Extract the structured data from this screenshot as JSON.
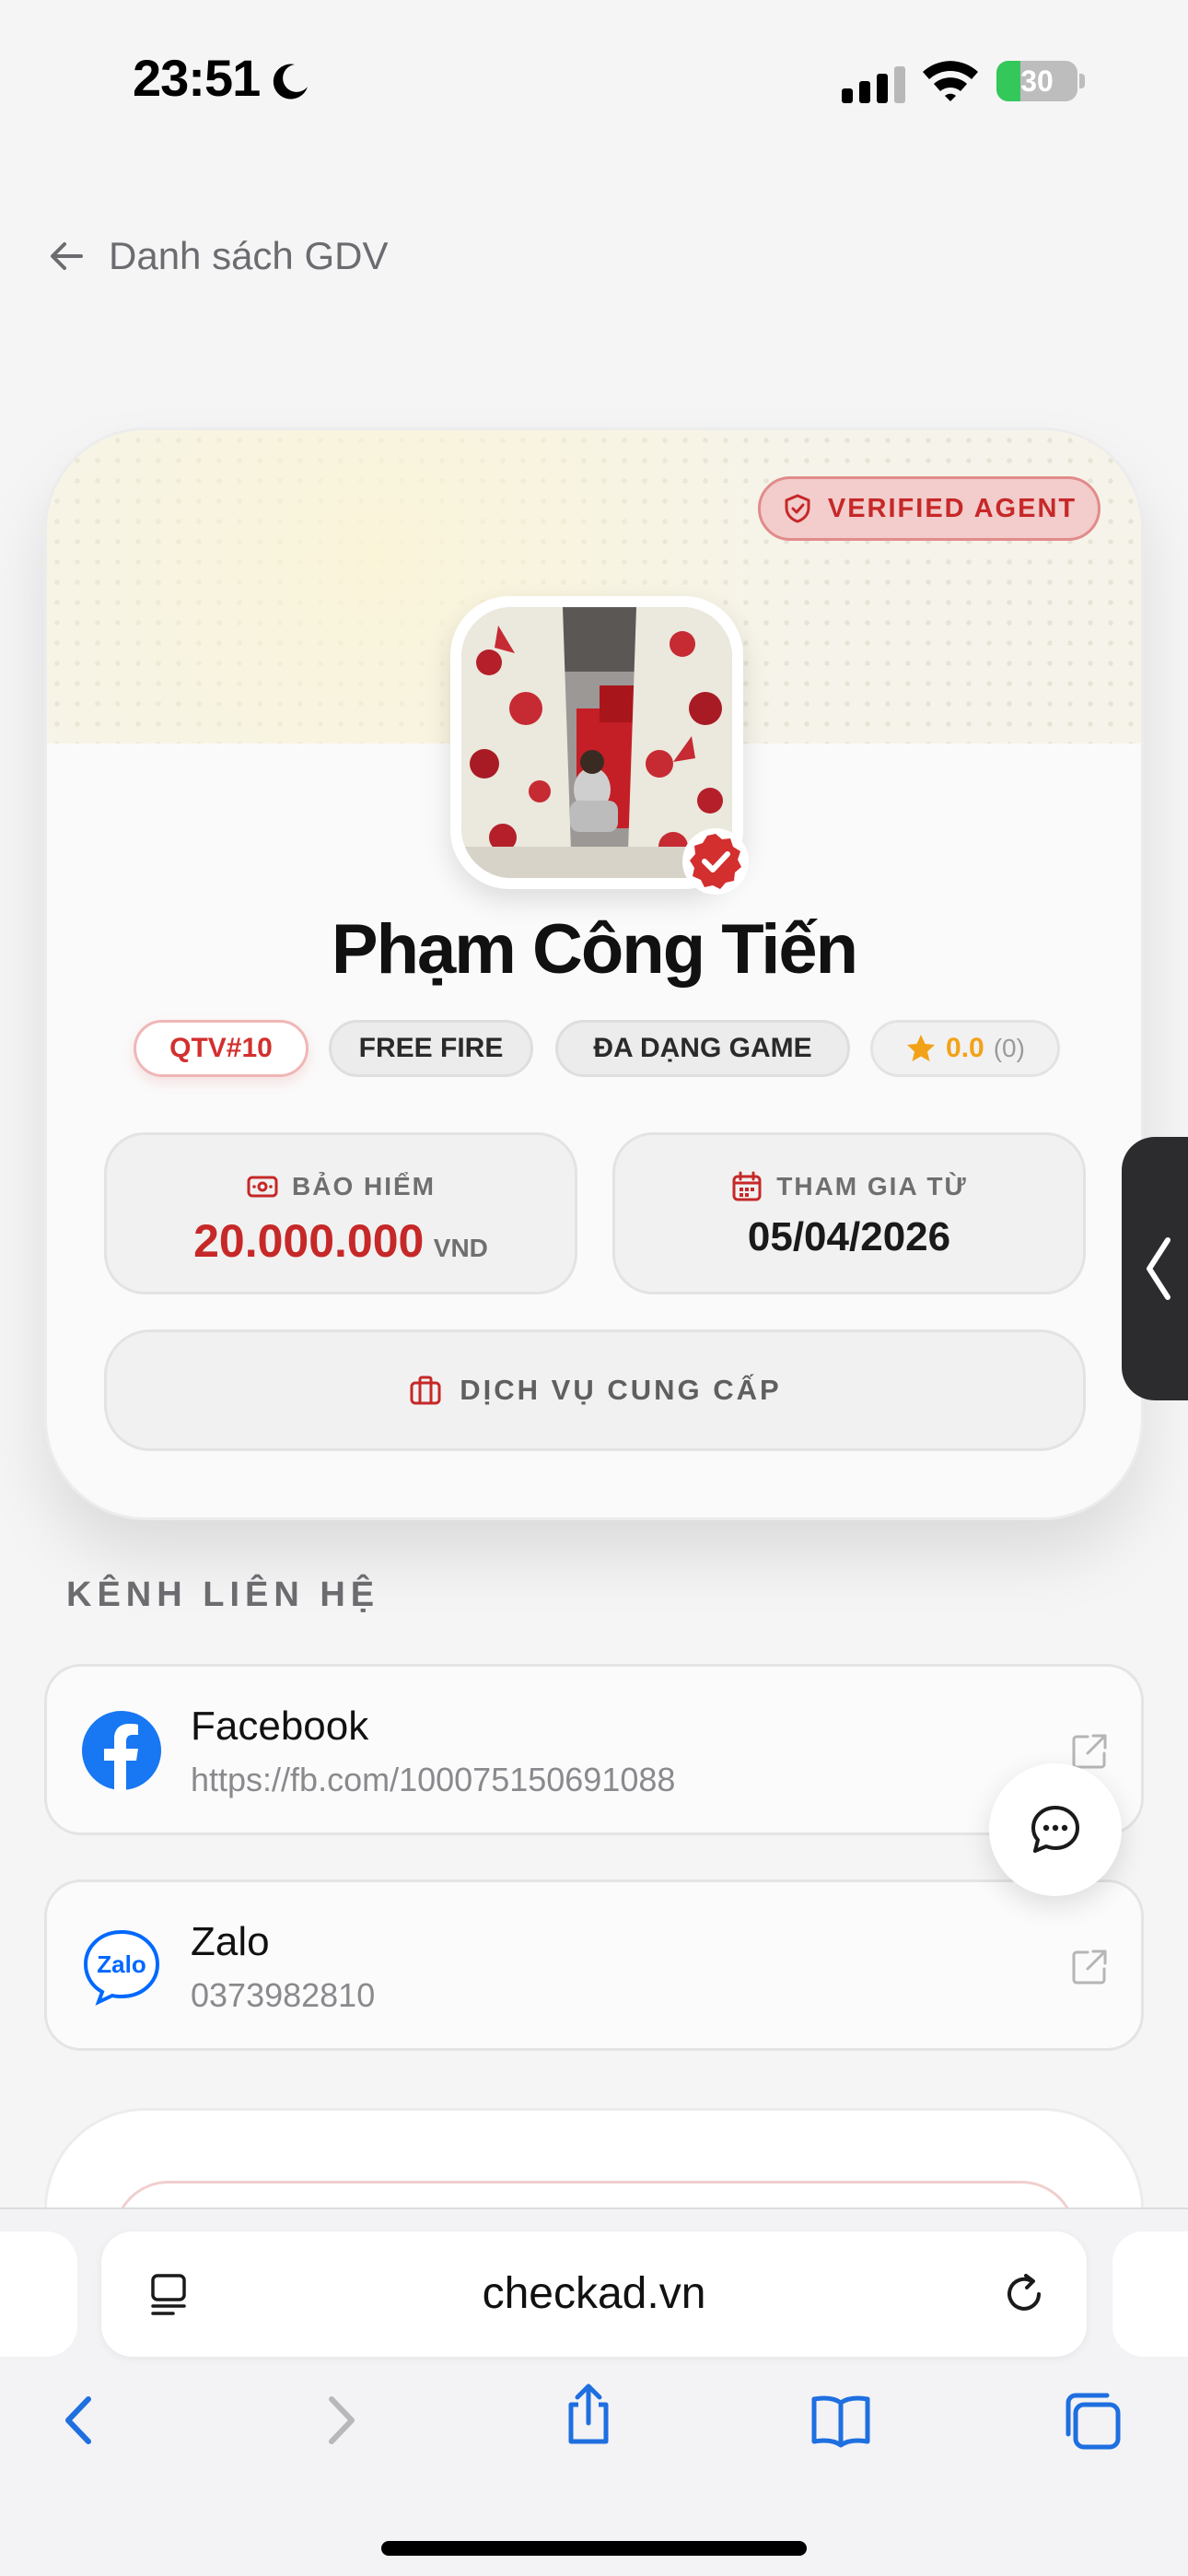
{
  "status_bar": {
    "time": "23:51",
    "battery_level": 30,
    "battery_label": "30"
  },
  "nav": {
    "back_label": "Danh sách GDV"
  },
  "profile": {
    "verified_label": "VERIFIED AGENT",
    "name": "Phạm Công Tiến",
    "tags": {
      "id": "QTV#10",
      "game": "FREE FIRE",
      "genre": "ĐA DẠNG GAME"
    },
    "rating": {
      "value": "0.0",
      "count": "(0)"
    },
    "insurance": {
      "label": "BẢO HIỂM",
      "amount": "20.000.000",
      "unit": "VND"
    },
    "joined": {
      "label": "THAM GIA TỪ",
      "date": "05/04/2026"
    },
    "services_label": "DỊCH VỤ CUNG CẤP"
  },
  "contacts": {
    "section_title": "KÊNH LIÊN HỆ",
    "items": [
      {
        "name": "Facebook",
        "value": "https://fb.com/100075150691088",
        "icon": "facebook-icon"
      },
      {
        "name": "Zalo",
        "value": "0373982810",
        "icon": "zalo-icon"
      }
    ]
  },
  "browser": {
    "address": "checkad.vn"
  },
  "colors": {
    "accent": "#c62828",
    "facebook": "#1877f2",
    "zalo": "#0068ff",
    "star": "#f2a218"
  }
}
